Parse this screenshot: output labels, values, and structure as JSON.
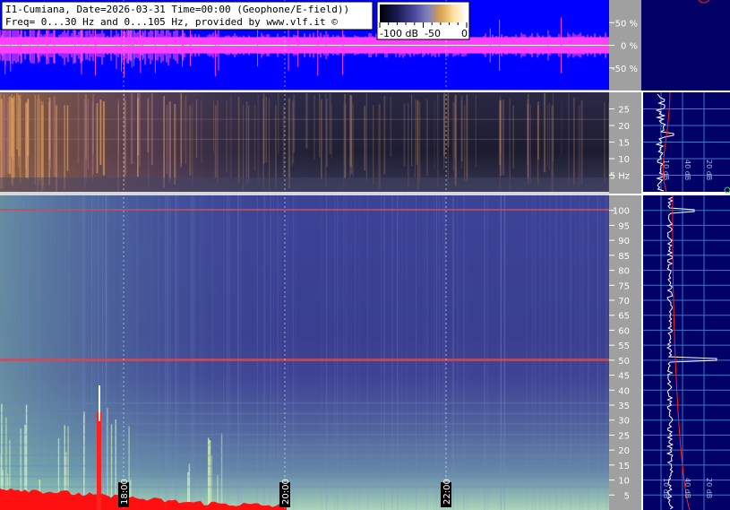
{
  "header": {
    "title_line": "I1-Cumiana, Date=2026-03-31 Time=00:00 (Geophone/E-field))",
    "freq_line": "Freq= 0...30 Hz and 0...105 Hz, provided by www.vlf.it ©"
  },
  "colorbar": {
    "tick_labels": [
      "-100 dB",
      "-50",
      "0"
    ],
    "stops": [
      "#000000",
      "#1a1a55",
      "#4a4a9a",
      "#8080c0",
      "#d8a050",
      "#ffe0a0",
      "#ffffff"
    ]
  },
  "colors": {
    "waveform_bg": "#0000ff",
    "waveform": "#ff40ff",
    "spectrum_panel_bg": "#000066",
    "axis_panel": "#a0a0a0",
    "spectrum_trace": "#ffffff",
    "reference_line": "#ff2020",
    "grid_line": "#3a78c8"
  },
  "chart_data": [
    {
      "type": "line",
      "panel": "waveform",
      "ylabel_ticks": [
        "50 %",
        "0 %",
        "-50 %"
      ],
      "y_values": [
        50,
        0,
        -50
      ],
      "ylim": [
        -100,
        100
      ],
      "x_time_ticks": [
        "18:00",
        "20:00",
        "22:00"
      ]
    },
    {
      "type": "heatmap",
      "panel": "spectrogram-low",
      "y_tick_values": [
        25,
        20,
        15,
        10,
        5
      ],
      "y_tick_labels": [
        "25",
        "20",
        "15",
        "10",
        "5 Hz"
      ],
      "ylim": [
        0,
        30
      ]
    },
    {
      "type": "heatmap",
      "panel": "spectrogram-high",
      "y_tick_values": [
        100,
        95,
        90,
        85,
        80,
        75,
        70,
        65,
        60,
        55,
        50,
        45,
        40,
        35,
        30,
        25,
        20,
        15,
        10,
        5
      ],
      "ylim": [
        0,
        105
      ],
      "x_time_ticks": [
        "18:00",
        "20:00",
        "22:00"
      ],
      "line_frequencies_hz": [
        50,
        100
      ]
    },
    {
      "type": "line",
      "panel": "spectrum-low",
      "x_tick_labels": [
        "10 dB",
        "40 dB",
        "20 dB"
      ]
    },
    {
      "type": "line",
      "panel": "spectrum-high",
      "x_tick_labels": [
        "10 dB",
        "40 dB",
        "20 dB"
      ]
    }
  ]
}
